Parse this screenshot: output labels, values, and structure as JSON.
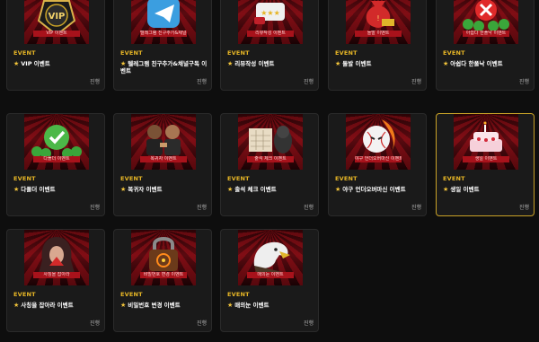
{
  "cards": [
    {
      "tag": "EVENT",
      "title": "VIP 이벤트",
      "status": "진행",
      "banner": "VIP 이벤트",
      "art": "vip-badge"
    },
    {
      "tag": "EVENT",
      "title": "텔레그램 친구추가&채널구독 이벤트",
      "status": "진행",
      "banner": "텔레그램 친구추가&채널구독",
      "art": "telegram"
    },
    {
      "tag": "EVENT",
      "title": "리뷰작성 이벤트",
      "status": "진행",
      "banner": "리뷰작성 이벤트",
      "art": "review"
    },
    {
      "tag": "EVENT",
      "title": "돌발 이벤트",
      "status": "진행",
      "banner": "돌발 이벤트",
      "art": "money-bag"
    },
    {
      "tag": "EVENT",
      "title": "아쉽다 한폴낙 이벤트",
      "status": "진행",
      "banner": "아쉽다 한폴낙 이벤트",
      "art": "red-x"
    },
    {
      "tag": "EVENT",
      "title": "다폴더 이벤트",
      "status": "진행",
      "banner": "다폴더 이벤트",
      "art": "green-check"
    },
    {
      "tag": "EVENT",
      "title": "복귀자 이벤트",
      "status": "진행",
      "banner": "복귀자 이벤트",
      "art": "returners"
    },
    {
      "tag": "EVENT",
      "title": "출석 체크 이벤트",
      "status": "진행",
      "banner": "출석 체크 이벤트",
      "art": "attendance"
    },
    {
      "tag": "EVENT",
      "title": "야구 언더오버마신 이벤트",
      "status": "진행",
      "banner": "야구 언더오버마신 이벤트",
      "art": "baseball"
    },
    {
      "tag": "EVENT",
      "title": "생일 이벤트",
      "status": "진행",
      "banner": "생일 이벤트",
      "art": "birthday-cake"
    },
    {
      "tag": "EVENT",
      "title": "사칭을 잡아라 이벤트",
      "status": "진행",
      "banner": "사칭을 잡아라",
      "art": "hooded-figure"
    },
    {
      "tag": "EVENT",
      "title": "비밀번호 변경 이벤트",
      "status": "진행",
      "banner": "비밀번호 변경 이벤트",
      "art": "padlock"
    },
    {
      "tag": "EVENT",
      "title": "매의눈 이벤트",
      "status": "진행",
      "banner": "매의눈 이벤트",
      "art": "eagle"
    }
  ]
}
